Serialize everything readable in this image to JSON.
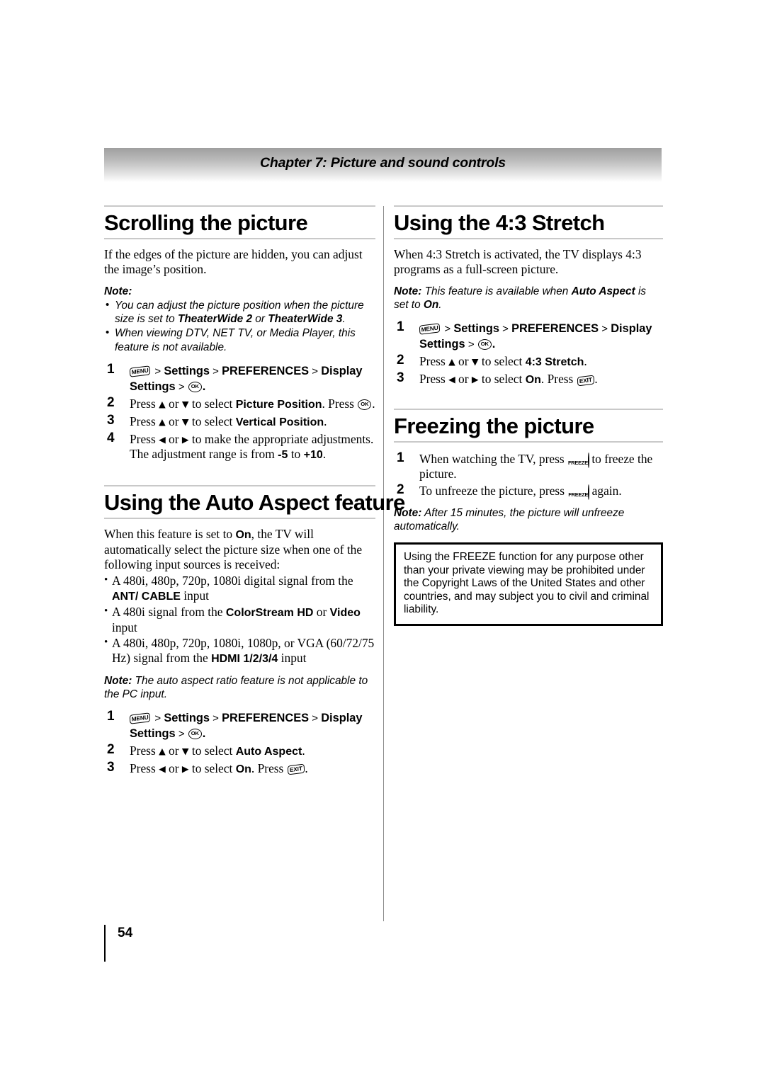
{
  "header": {
    "chapter_title": "Chapter 7: Picture and sound controls"
  },
  "keys": {
    "menu": "MENU",
    "ok": "OK",
    "exit": "EXIT",
    "freeze": "FREEZE"
  },
  "left_column": {
    "sections": [
      {
        "title": "Scrolling the picture",
        "intro": "If the edges of the picture are hidden, you can adjust the image’s position.",
        "note_label": "Note:",
        "note_bullets": [
          {
            "pre": "You can adjust the picture position when the picture size is set to ",
            "bold1": "TheaterWide 2",
            "mid": " or ",
            "bold2": "TheaterWide 3",
            "post": "."
          },
          {
            "pre": "When viewing DTV, NET TV, or Media Player, this feature is not available.",
            "bold1": "",
            "mid": "",
            "bold2": "",
            "post": ""
          }
        ],
        "steps": [
          {
            "type": "menupath",
            "parts": [
              "Settings",
              "PREFERENCES",
              "Display Settings"
            ],
            "trailing": "."
          },
          {
            "type": "text",
            "pre": "Press ",
            "arrow_up": "▲",
            "mid1": " or ",
            "arrow_down": "▼",
            "mid2": " to select ",
            "bold": "Picture Position",
            "post": ". Press ",
            "key": "ok",
            "end": "."
          },
          {
            "type": "text",
            "pre": "Press ",
            "arrow_up": "▲",
            "mid1": " or ",
            "arrow_down": "▼",
            "mid2": " to select ",
            "bold": "Vertical Position",
            "post": ".",
            "key": "",
            "end": ""
          },
          {
            "type": "adjust",
            "pre": "Press ",
            "arrow_left": "◀",
            "mid1": " or ",
            "arrow_right": "▶",
            "mid2": " to make the appropriate adjustments. The adjustment range is from ",
            "bold1": "-5",
            "mid3": " to ",
            "bold2": "+10",
            "post": "."
          }
        ]
      },
      {
        "title": "Using the Auto Aspect feature",
        "intro_pre": "When this feature is set to ",
        "intro_bold": "On",
        "intro_post": ", the TV will automatically select the picture size when one of the following input sources is received:",
        "bullets": [
          {
            "pre": "A 480i, 480p, 720p, 1080i digital signal from the ",
            "bold": "ANT/ CABLE",
            "post": " input"
          },
          {
            "pre": "A 480i signal from the ",
            "bold": "ColorStream HD",
            "mid": " or ",
            "bold2": "Video",
            "post": " input"
          },
          {
            "pre": "A 480i, 480p, 720p, 1080i, 1080p, or VGA (60/72/75 Hz) signal from the ",
            "bold": "HDMI 1/2/3/4",
            "post": " input"
          }
        ],
        "note_label": "Note:",
        "note_text": "The auto aspect ratio feature is not applicable to the PC input.",
        "steps": [
          {
            "type": "menupath",
            "parts": [
              "Settings",
              "PREFERENCES",
              "Display Settings"
            ],
            "trailing": "."
          },
          {
            "type": "text",
            "pre": "Press ",
            "arrow_up": "▲",
            "mid1": " or ",
            "arrow_down": "▼",
            "mid2": " to select ",
            "bold": "Auto Aspect",
            "post": "."
          },
          {
            "type": "onoff",
            "pre": "Press ",
            "arrow_left": "◀",
            "mid1": " or ",
            "arrow_right": "▶",
            "mid2": " to select ",
            "bold": "On",
            "post": ". Press ",
            "end": "."
          }
        ]
      }
    ]
  },
  "right_column": {
    "sections": [
      {
        "title": "Using the 4:3 Stretch",
        "intro": "When 4:3 Stretch is activated, the TV displays 4:3 programs as a full-screen picture.",
        "note_label": "Note:",
        "note_pre": "This feature is available when ",
        "note_bold1": "Auto Aspect",
        "note_mid": " is set to ",
        "note_bold2": "On",
        "note_post": ".",
        "steps": [
          {
            "type": "menupath",
            "parts": [
              "Settings",
              "PREFERENCES",
              "Display Settings"
            ],
            "trailing": "."
          },
          {
            "type": "text",
            "pre": "Press ",
            "arrow_up": "▲",
            "mid1": " or ",
            "arrow_down": "▼",
            "mid2": " to select ",
            "bold": "4:3 Stretch",
            "post": "."
          },
          {
            "type": "onoff",
            "pre": "Press ",
            "arrow_left": "◀",
            "mid1": " or ",
            "arrow_right": "▶",
            "mid2": " to select ",
            "bold": "On",
            "post": ". Press ",
            "end": "."
          }
        ]
      },
      {
        "title": "Freezing the picture",
        "steps": [
          {
            "type": "freeze1",
            "pre": "When watching the TV, press ",
            "post": " to freeze the picture."
          },
          {
            "type": "freeze2",
            "pre": "To unfreeze the picture, press ",
            "post": " again."
          }
        ],
        "note_label": "Note:",
        "note_text": "After 15 minutes, the picture will unfreeze automatically.",
        "caution": "Using the FREEZE function for any purpose other than your private viewing may be prohibited under the Copyright Laws of the United States and other countries, and may subject you to civil and criminal liability."
      }
    ]
  },
  "footer": {
    "page_number": "54"
  }
}
